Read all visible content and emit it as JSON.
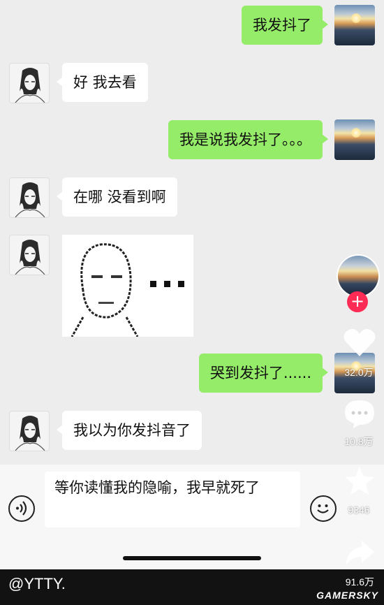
{
  "messages": [
    {
      "side": "right",
      "text": "我发抖了"
    },
    {
      "side": "left",
      "text": "好 我去看"
    },
    {
      "side": "right",
      "text": "我是说我发抖了。。。"
    },
    {
      "side": "left",
      "text": "在哪 没看到啊"
    },
    {
      "side": "left",
      "sticker": "pixel-face-ellipsis"
    },
    {
      "side": "right",
      "text": "哭到发抖了......"
    },
    {
      "side": "left",
      "text": "我以为你发抖音了"
    }
  ],
  "input": {
    "value": "等你读懂我的隐喻，我早就死了"
  },
  "side_actions": {
    "likes": "32.0万",
    "comments": "10.8万",
    "favorites": "9346",
    "shares": "91.6万"
  },
  "footer": {
    "handle": "@YTTY.",
    "watermark": "GAMERSKY"
  },
  "colors": {
    "sent_bubble": "#95ec69",
    "received_bubble": "#ffffff",
    "follow": "#fe2c55",
    "background": "#ededed"
  }
}
